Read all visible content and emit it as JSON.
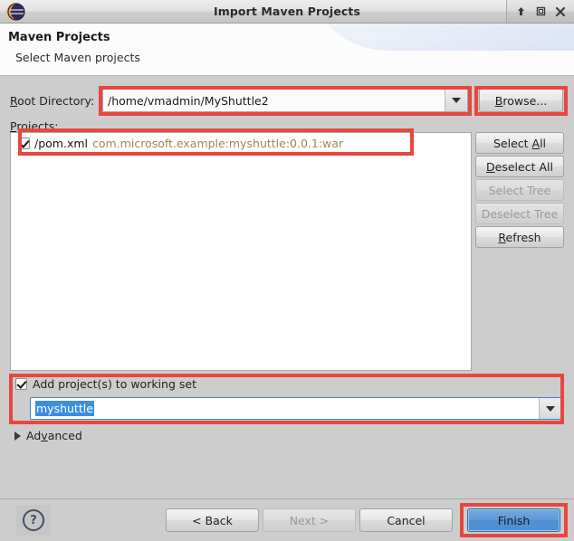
{
  "window": {
    "title": "Import Maven Projects",
    "icon": "eclipse-logo-icon",
    "controls": [
      {
        "name": "shade-icon",
        "glyph": "↑"
      },
      {
        "name": "maximize-icon",
        "glyph": "☐"
      },
      {
        "name": "close-icon",
        "glyph": "✕"
      }
    ]
  },
  "header": {
    "title": "Maven Projects",
    "subtitle": "Select Maven projects"
  },
  "form": {
    "root_directory_label": "Root Directory:",
    "root_directory_mnemonic": "R",
    "root_directory_value": "/home/vmadmin/MyShuttle2",
    "browse_label": "Browse...",
    "browse_mnemonic": "B",
    "projects_label": "Projects:",
    "projects_mnemonic": "P"
  },
  "projects": {
    "rows": [
      {
        "checked": true,
        "name": "/pom.xml",
        "coordinates": "com.microsoft.example:myshuttle:0.0.1:war"
      }
    ]
  },
  "side_buttons": [
    {
      "label": "Select All",
      "pre": "Select ",
      "mnemonic": "A",
      "post": "ll",
      "enabled": true
    },
    {
      "label": "Deselect All",
      "pre": "",
      "mnemonic": "D",
      "post": "eselect All",
      "enabled": true
    },
    {
      "label": "Select Tree",
      "pre": "Select Tree",
      "mnemonic": "",
      "post": "",
      "enabled": false
    },
    {
      "label": "Deselect Tree",
      "pre": "Deselect Tree",
      "mnemonic": "",
      "post": "",
      "enabled": false
    },
    {
      "label": "Refresh",
      "pre": "",
      "mnemonic": "R",
      "post": "efresh",
      "enabled": true
    }
  ],
  "working_set": {
    "checkbox_label": "Add project(s) to working set",
    "checked": true,
    "value": "myshuttle",
    "selected": true
  },
  "advanced": {
    "pre": "Ad",
    "mnemonic": "v",
    "post": "anced",
    "expanded": false
  },
  "footer": {
    "help_glyph": "?",
    "buttons": [
      {
        "label": "< Back",
        "enabled": true,
        "primary": false
      },
      {
        "label": "Next >",
        "enabled": false,
        "primary": false
      },
      {
        "label": "Cancel",
        "enabled": true,
        "primary": false
      },
      {
        "label": "Finish",
        "enabled": true,
        "primary": true
      }
    ]
  },
  "annotations": {
    "color": "#e8473f",
    "count": 5
  }
}
